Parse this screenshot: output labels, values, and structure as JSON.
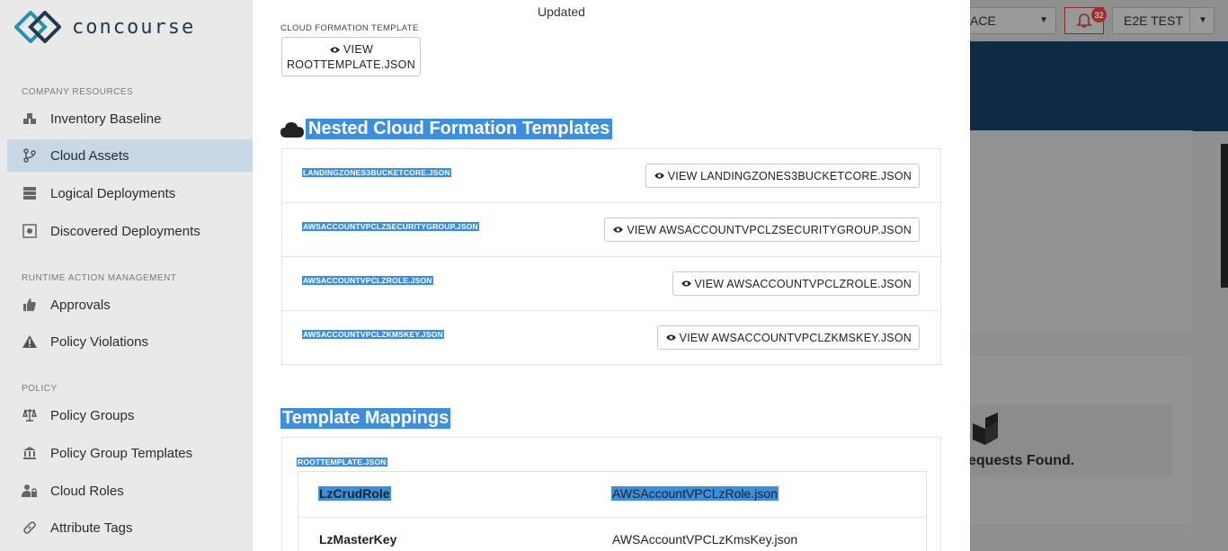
{
  "app": {
    "name": "concourse"
  },
  "sidebar": {
    "sections": [
      {
        "title": "COMPANY RESOURCES"
      },
      {
        "title": "RUNTIME ACTION MANAGEMENT"
      },
      {
        "title": "POLICY"
      }
    ],
    "items": [
      {
        "label": "Inventory Baseline",
        "icon": "boxes-icon"
      },
      {
        "label": "Cloud Assets",
        "icon": "branch-icon",
        "active": true
      },
      {
        "label": "Logical Deployments",
        "icon": "server-icon"
      },
      {
        "label": "Discovered Deployments",
        "icon": "scan-icon"
      },
      {
        "label": "Approvals",
        "icon": "thumbs-up-icon"
      },
      {
        "label": "Policy Violations",
        "icon": "warning-icon"
      },
      {
        "label": "Policy Groups",
        "icon": "scale-icon"
      },
      {
        "label": "Policy Group Templates",
        "icon": "bank-icon"
      },
      {
        "label": "Cloud Roles",
        "icon": "user-lock-icon"
      },
      {
        "label": "Attribute Tags",
        "icon": "link-icon"
      }
    ]
  },
  "header": {
    "workspace_label": "ACE",
    "notification_count": "32",
    "user_label": "E2E TEST"
  },
  "background": {
    "no_requests": "equests Found."
  },
  "modal": {
    "updated_label": "Updated",
    "cft_label": "CLOUD FORMATION TEMPLATE",
    "view_root_line1": "VIEW",
    "view_root_line2": "ROOTTEMPLATE.JSON",
    "nested_title": "Nested Cloud Formation Templates",
    "nested": [
      {
        "file": "LANDINGZONES3BUCKETCORE.JSON",
        "button": "VIEW LANDINGZONES3BUCKETCORE.JSON"
      },
      {
        "file": "AWSACCOUNTVPCLZSECURITYGROUP.JSON",
        "button": "VIEW AWSACCOUNTVPCLZSECURITYGROUP.JSON"
      },
      {
        "file": "AWSACCOUNTVPCLZROLE.JSON",
        "button": "VIEW AWSACCOUNTVPCLZROLE.JSON"
      },
      {
        "file": "AWSACCOUNTVPCLZKMSKEY.JSON",
        "button": "VIEW AWSACCOUNTVPCLZKMSKEY.JSON"
      }
    ],
    "mappings_title": "Template Mappings",
    "mapping_root": "ROOTTEMPLATE.JSON",
    "mappings": [
      {
        "key": "LzCrudRole",
        "value": "AWSAccountVPCLzRole.json"
      },
      {
        "key": "LzMasterKey",
        "value": "AWSAccountVPCLzKmsKey.json"
      }
    ]
  },
  "colors": {
    "highlight": "#3e8ede",
    "banner": "#0f2a45",
    "active_nav": "#c7d7e3"
  }
}
